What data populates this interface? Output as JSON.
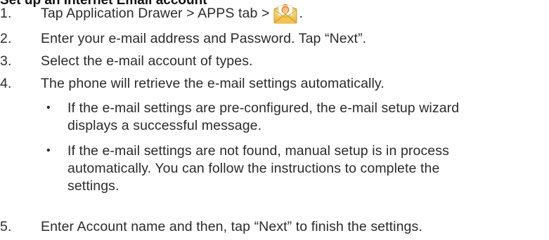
{
  "heading": "Set up an Internet Email account",
  "steps": [
    {
      "num": "1.",
      "before_icon": "Tap Application Drawer > APPS tab >",
      "icon": "email-app-icon",
      "after_icon": "."
    },
    {
      "num": "2.",
      "text": "Enter your e-mail address and Password. Tap “Next”."
    },
    {
      "num": "3.",
      "text": "Select the e-mail account of types."
    },
    {
      "num": "4.",
      "text": "The phone will retrieve the e-mail settings automatically."
    },
    {
      "num": "5.",
      "text": "Enter Account name and then, tap “Next” to finish the settings."
    }
  ],
  "bullets": [
    {
      "marker": "•",
      "lines": [
        "If the e-mail settings are pre-configured, the e-mail setup wizard",
        "displays a successful message."
      ]
    },
    {
      "marker": "•",
      "lines": [
        "If the e-mail settings are not found, manual setup is in process",
        "automatically. You can follow the instructions to complete the",
        "settings."
      ]
    }
  ],
  "colors": {
    "text": "#2b2b2b",
    "icon_envelope": "#f2c94c",
    "icon_at": "#f28c28"
  }
}
